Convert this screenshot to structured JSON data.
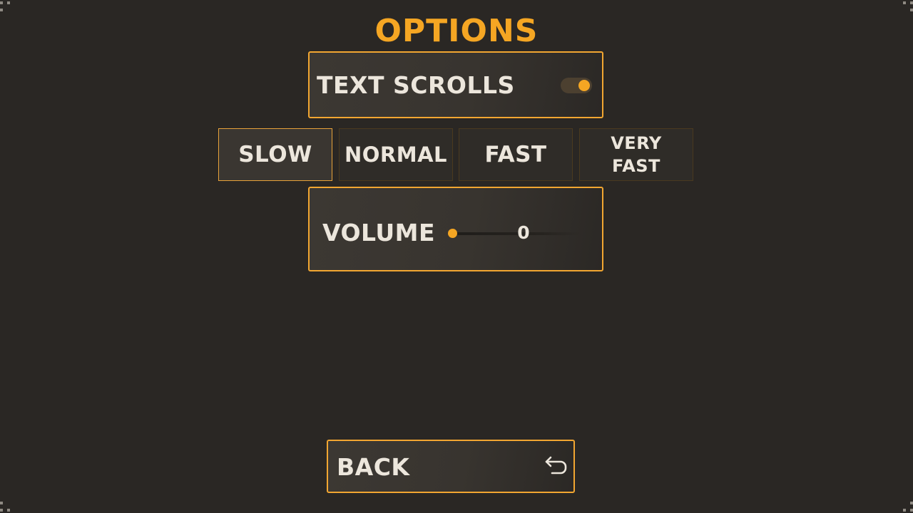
{
  "title": "OPTIONS",
  "text_scrolls": {
    "label": "TEXT SCROLLS",
    "enabled": true
  },
  "scroll_speed": {
    "options": [
      {
        "label": "SLOW",
        "lines": [
          "SLOW"
        ]
      },
      {
        "label": "NORMAL",
        "lines": [
          "NORMAL"
        ]
      },
      {
        "label": "FAST",
        "lines": [
          "FAST"
        ]
      },
      {
        "label": "VERY FAST",
        "lines": [
          "VERY",
          "FAST"
        ]
      }
    ],
    "selected": "SLOW"
  },
  "volume": {
    "label": "VOLUME",
    "value": "0",
    "level": 0
  },
  "back": {
    "label": "BACK",
    "icon": "return-arrow-icon"
  },
  "colors": {
    "accent": "#f5a623",
    "background": "#2a2724",
    "text": "#ece6dc"
  }
}
